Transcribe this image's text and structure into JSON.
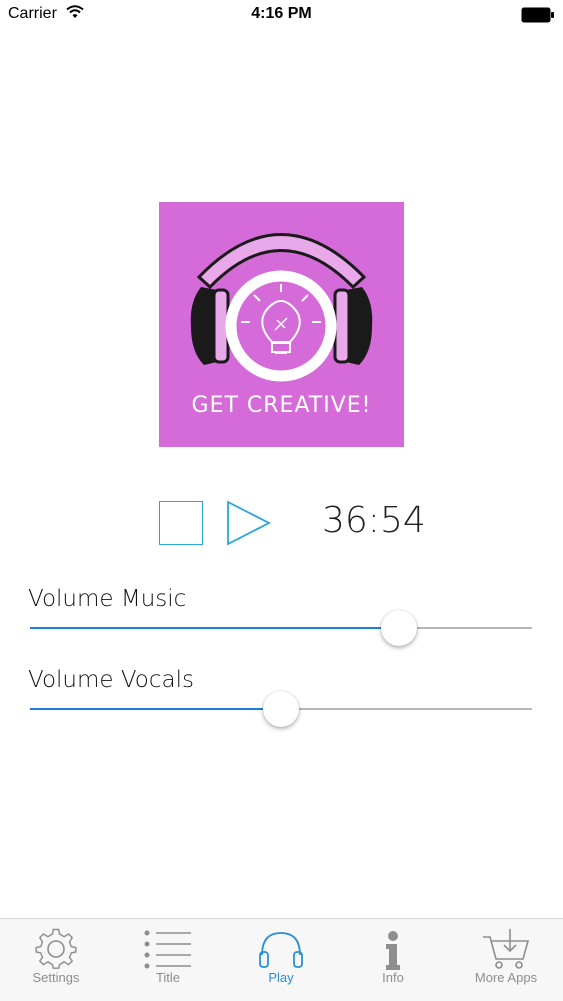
{
  "status_bar": {
    "carrier": "Carrier",
    "time": "4:16 PM"
  },
  "artwork": {
    "text": "GET CREATIVE!",
    "background_color": "#d56bd8"
  },
  "player": {
    "time_remaining": "36:54",
    "accent_color": "#2aa6d9"
  },
  "sliders": [
    {
      "label": "Volume Music",
      "value": 0.735
    },
    {
      "label": "Volume Vocals",
      "value": 0.5
    }
  ],
  "tabs": [
    {
      "label": "Settings",
      "icon": "gear-icon",
      "active": false
    },
    {
      "label": "Title",
      "icon": "list-icon",
      "active": false
    },
    {
      "label": "Play",
      "icon": "headphones-icon",
      "active": true
    },
    {
      "label": "Info",
      "icon": "info-icon",
      "active": false
    },
    {
      "label": "More Apps",
      "icon": "cart-icon",
      "active": false
    }
  ],
  "colors": {
    "tab_active": "#2a8fd6",
    "tab_inactive": "#8e8e8e",
    "slider_fill": "#1b7fd6"
  }
}
